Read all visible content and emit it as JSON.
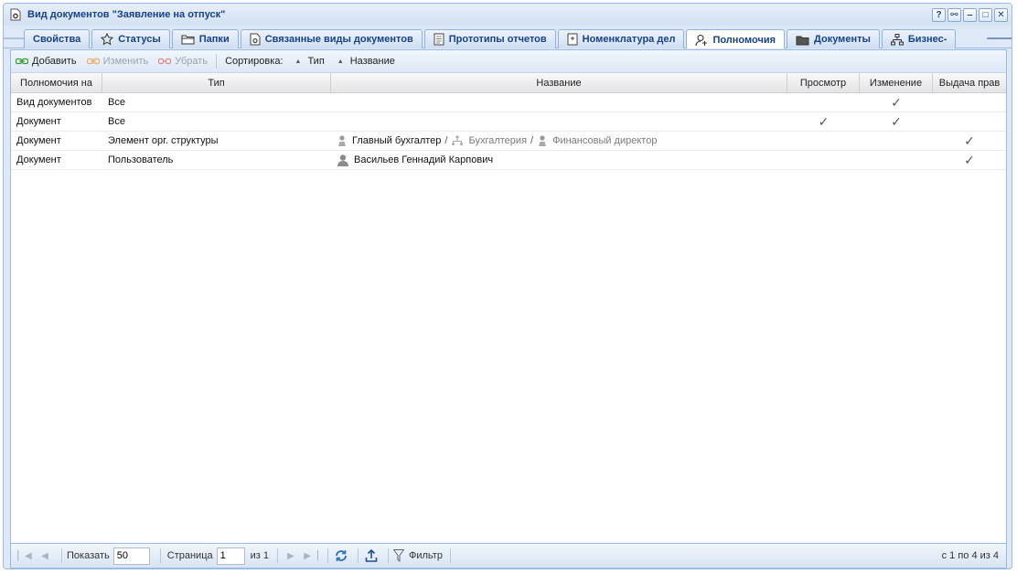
{
  "window": {
    "title": "Вид документов \"Заявление на отпуск\"",
    "tools": [
      {
        "name": "help",
        "glyph": "?"
      },
      {
        "name": "binoculars",
        "glyph": "⚯"
      },
      {
        "name": "minimize",
        "glyph": "‒"
      },
      {
        "name": "maximize",
        "glyph": "□"
      },
      {
        "name": "close",
        "glyph": "✕"
      }
    ]
  },
  "tabs": [
    {
      "label": "Свойства",
      "icon": "none",
      "active": false
    },
    {
      "label": "Статусы",
      "icon": "star-icon",
      "active": false
    },
    {
      "label": "Папки",
      "icon": "folder-icon",
      "active": false
    },
    {
      "label": "Связанные виды документов",
      "icon": "linked-doc-icon",
      "active": false
    },
    {
      "label": "Прототипы отчетов",
      "icon": "report-icon",
      "active": false
    },
    {
      "label": "Номенклатура дел",
      "icon": "nomenclature-icon",
      "active": false
    },
    {
      "label": "Полномочия",
      "icon": "permissions-icon",
      "active": true
    },
    {
      "label": "Документы",
      "icon": "documents-icon",
      "active": false
    },
    {
      "label": "Бизнес-",
      "icon": "business-icon",
      "active": false
    }
  ],
  "toolbar": {
    "add_label": "Добавить",
    "edit_label": "Изменить",
    "remove_label": "Убрать",
    "sort_label": "Сортировка:",
    "sort_type_label": "Тип",
    "sort_name_label": "Название"
  },
  "grid": {
    "columns": [
      "Полномочия на",
      "Тип",
      "Название",
      "Просмотр",
      "Изменение",
      "Выдача прав"
    ],
    "rows": [
      {
        "on": "Вид документов",
        "type": "Все",
        "name": [],
        "view": false,
        "edit": true,
        "grant": false
      },
      {
        "on": "Документ",
        "type": "Все",
        "name": [],
        "view": true,
        "edit": true,
        "grant": false
      },
      {
        "on": "Документ",
        "type": "Элемент орг. структуры",
        "name": [
          {
            "text": "Главный бухгалтер",
            "icon": "position-icon",
            "muted": false
          },
          {
            "text": "Бухгалтерия",
            "icon": "department-icon",
            "muted": true
          },
          {
            "text": "Финансовый директор",
            "icon": "position-icon",
            "muted": true
          }
        ],
        "view": false,
        "edit": false,
        "grant": true
      },
      {
        "on": "Документ",
        "type": "Пользователь",
        "name": [
          {
            "text": "Васильев Геннадий Карпович",
            "icon": "user-icon",
            "muted": false
          }
        ],
        "view": false,
        "edit": false,
        "grant": true
      }
    ],
    "check_glyph": "✓"
  },
  "paging": {
    "show_label": "Показать",
    "page_size": "50",
    "page_label": "Страница",
    "page_value": "1",
    "of_label": "из 1",
    "filter_label": "Фильтр",
    "info": "с 1 по 4 из 4"
  },
  "colors": {
    "accent": "#15428b",
    "border": "#99bbe8"
  }
}
